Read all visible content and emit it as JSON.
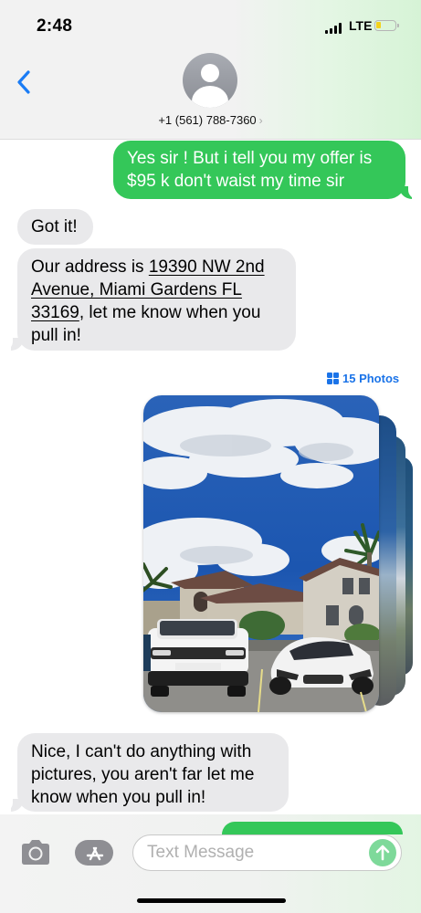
{
  "status_bar": {
    "time": "2:48",
    "network": "LTE",
    "battery_color": "#f3d21c"
  },
  "header": {
    "contact": "+1 (561) 788-7360",
    "chevron": "›"
  },
  "messages": [
    {
      "direction": "outgoing",
      "text": "Yes sir ! But i tell you my offer is $95 k don't waist my time sir"
    },
    {
      "direction": "incoming",
      "text": "Got it!"
    },
    {
      "direction": "incoming",
      "prefix": "Our address is ",
      "link_text": "19390 NW 2nd Avenue, Miami Gardens FL 33169",
      "suffix": ", let me know when you pull in!"
    },
    {
      "direction": "incoming",
      "text": "Nice, I can't do anything with pictures, you aren't far let me know when you pull in!"
    }
  ],
  "photos": {
    "label": "15 Photos"
  },
  "composer": {
    "placeholder": "Text Message"
  },
  "colors": {
    "outgoing": "#34c759",
    "incoming": "#e9e9eb",
    "link": "#1a73e8",
    "back": "#1a7cf5"
  },
  "icons": [
    "back-chevron-icon",
    "contact-avatar-icon",
    "signal-icon",
    "battery-icon",
    "photo-grid-icon",
    "camera-icon",
    "app-store-icon",
    "send-arrow-icon"
  ]
}
